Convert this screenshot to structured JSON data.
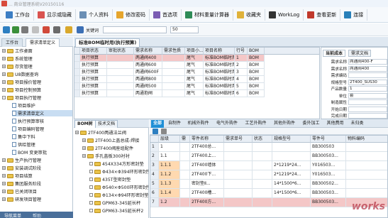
{
  "window": {
    "title": "... 商业管理系统V20150116"
  },
  "menubar": {
    "items": [
      {
        "label": "工作台",
        "icon": "home-icon"
      },
      {
        "label": "显示或隐藏",
        "icon": "layout-icon"
      },
      {
        "label": "个人资料",
        "icon": "user-icon"
      },
      {
        "label": "修改密码",
        "icon": "key-icon"
      },
      {
        "label": "首选项",
        "icon": "gear-icon"
      },
      {
        "label": "材料重量计算器",
        "icon": "calculator-icon"
      },
      {
        "label": "收藏夹",
        "icon": "star-icon"
      },
      {
        "label": "WorkLog",
        "icon": "worklog-icon"
      },
      {
        "label": "查看更新",
        "icon": "update-icon"
      },
      {
        "label": "连接",
        "icon": "link-icon"
      }
    ]
  },
  "toolbar": {
    "keyword_label": "关键词",
    "keyword_value": "",
    "page_size": "50"
  },
  "left_tabs": [
    "工作台",
    "需求清单定义"
  ],
  "tree": [
    {
      "label": "工作桌面",
      "level": 0,
      "type": "folder",
      "expander": "+"
    },
    {
      "label": "系统管理",
      "level": 0,
      "type": "folder",
      "expander": "+"
    },
    {
      "label": "存货管理",
      "level": 0,
      "type": "folder",
      "expander": "+"
    },
    {
      "label": "U8数据查询",
      "level": 0,
      "type": "folder",
      "expander": "+"
    },
    {
      "label": "项目报价管理",
      "level": 0,
      "type": "folder",
      "expander": "+"
    },
    {
      "label": "项目控制预算",
      "level": 0,
      "type": "folder",
      "expander": "+"
    },
    {
      "label": "项目执行管理",
      "level": 0,
      "type": "folder",
      "expander": "-"
    },
    {
      "label": "项目维护",
      "level": 1,
      "type": "doc",
      "expander": ""
    },
    {
      "label": "需求清单定义",
      "level": 1,
      "type": "doc",
      "expander": "",
      "selected": true
    },
    {
      "label": "执行预算审核",
      "level": 1,
      "type": "doc",
      "expander": ""
    },
    {
      "label": "项目编码管理",
      "level": 1,
      "type": "doc",
      "expander": ""
    },
    {
      "label": "集中下料",
      "level": 1,
      "type": "doc",
      "expander": ""
    },
    {
      "label": "供给管理",
      "level": 1,
      "type": "doc",
      "expander": ""
    },
    {
      "label": "BOM 变更审批",
      "level": 1,
      "type": "doc",
      "expander": ""
    },
    {
      "label": "生产执行管理",
      "level": 0,
      "type": "folder",
      "expander": "+"
    },
    {
      "label": "安装调试阶段",
      "level": 0,
      "type": "folder",
      "expander": "+"
    },
    {
      "label": "项目结算",
      "level": 0,
      "type": "folder",
      "expander": "+"
    },
    {
      "label": "集团服务阶段",
      "level": 0,
      "type": "folder",
      "expander": "+"
    },
    {
      "label": "已关闭项目",
      "level": 0,
      "type": "folder",
      "expander": "+"
    },
    {
      "label": "研发项目管理",
      "level": 0,
      "type": "folder",
      "expander": "+"
    }
  ],
  "left_bottom": {
    "nav": "导航菜单",
    "help": "帮助"
  },
  "main_tab": "标准BOM临时用(执行预算)",
  "top_grid": {
    "headers": [
      "项目状态",
      "审批状态",
      "需求名称",
      "需求性质",
      "项目小...",
      "项目名称",
      "行号",
      "BOM"
    ],
    "rows": [
      [
        "执行预算",
        "",
        "两通阀400",
        "",
        "尾气",
        "标准BOM临时用",
        "1",
        "BOM"
      ],
      [
        "执行预算",
        "",
        "两通阀600",
        "",
        "尾气",
        "标准BOM临时用",
        "2",
        "BOM"
      ],
      [
        "执行预算",
        "",
        "两通阀600F",
        "",
        "尾气",
        "标准BOM临时用",
        "3",
        "BOM"
      ],
      [
        "执行预算",
        "",
        "两通阀800",
        "",
        "尾气",
        "标准BOM临时用",
        "4",
        "BOM"
      ],
      [
        "执行预算",
        "",
        "两通阀500",
        "",
        "尾气",
        "标准BOM临时用",
        "5",
        "BOM"
      ],
      [
        "执行预算",
        "",
        "两通抱闸",
        "",
        "尾气",
        "标准BOM临时用",
        "6",
        "BOM"
      ]
    ]
  },
  "right_panel": {
    "tabs": [
      "当前成本",
      "需求文档"
    ],
    "fields": [
      {
        "label": "需求名称",
        "value": "两通阀400-F"
      },
      {
        "label": "需求名称",
        "value": "两通阀400"
      },
      {
        "label": "需求编码",
        "value": ""
      },
      {
        "label": "规格型号",
        "value": "2T400_SUS30"
      },
      {
        "label": "产品数量",
        "value": "1"
      },
      {
        "label": "单位",
        "value": "套"
      },
      {
        "label": "制造属性",
        "value": ""
      },
      {
        "label": "开始日期",
        "value": ""
      },
      {
        "label": "完成日期",
        "value": ""
      }
    ]
  },
  "bom_tabs": [
    "BOM树",
    "技术文档"
  ],
  "bom_tree": [
    {
      "label": "2TF400两通法兰阀",
      "level": 0
    },
    {
      "label": "2TF400上盖总成-焊接",
      "level": 1
    },
    {
      "label": "2TF400阀座组配件",
      "level": 1
    },
    {
      "label": "手孔盖板300衬衬",
      "level": 1
    },
    {
      "label": "454X334方形密封垫",
      "level": 2
    },
    {
      "label": "Φ434×Φ394环形密封垫",
      "level": 2
    },
    {
      "label": "435T型密封垫",
      "level": 2
    },
    {
      "label": "Φ540×Φ500环形密封垫",
      "level": 2
    },
    {
      "label": "Φ134×Φ94环形密封垫",
      "level": 2
    },
    {
      "label": "GPM63-345延长杆",
      "level": 2
    },
    {
      "label": "GPM63-345延长杆2",
      "level": 2
    }
  ],
  "detail_tabs": [
    "全部",
    "自制件",
    "机械外购件",
    "电气外购件",
    "工艺外购件",
    "其他外购件",
    "委外加工",
    "其他费用",
    "未归类"
  ],
  "detail_grid": {
    "headers": [
      "",
      "层级",
      "需",
      "零件名称",
      "需求单号",
      "状态",
      "规格型号",
      "零件号",
      "物料编码"
    ],
    "rows": [
      [
        "1",
        "1",
        "",
        "2TF400总...",
        "",
        "",
        "",
        "BB300503",
        ""
      ],
      [
        "2",
        "1.1",
        "",
        "2TF400上...",
        "",
        "",
        "",
        "BB300503...",
        ""
      ],
      [
        "3",
        "1.1.1",
        "",
        "2TF400墙体",
        "",
        "",
        "2*1219*24...",
        "Y016503...",
        ""
      ],
      [
        "4",
        "1.1.2",
        "",
        "2TF400下...",
        "",
        "",
        "2*1219*24...",
        "Y016503...",
        ""
      ],
      [
        "5",
        "1.1.3",
        "",
        "密封垫Ⅱ...",
        "",
        "",
        "14*1500*6...",
        "BB300502...",
        ""
      ],
      [
        "6",
        "1.1.4",
        "",
        "2TF400槽...",
        "",
        "",
        "14*1500*6...",
        "BB300503...",
        ""
      ],
      [
        "7",
        "1.2",
        "",
        "2TF400方...",
        "",
        "",
        "",
        "BB300503...",
        ""
      ]
    ]
  },
  "watermark": "works"
}
